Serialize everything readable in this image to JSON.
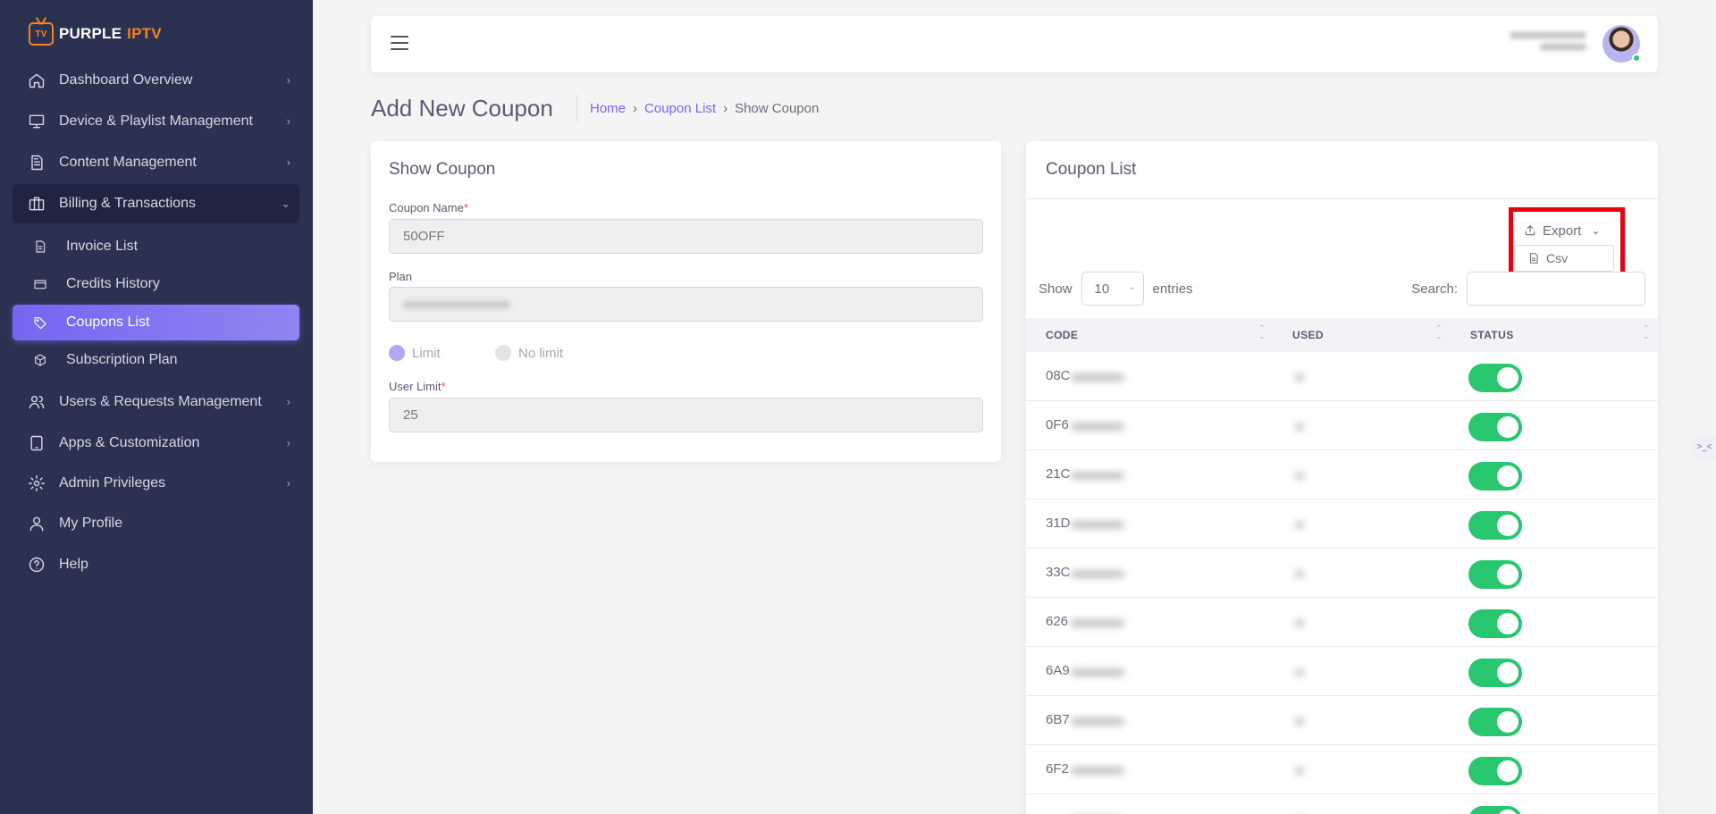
{
  "brand": {
    "purple": "PURPLE",
    "iptv": "IPTV",
    "tv": "TV",
    "accent": "#f58220"
  },
  "sidebar": {
    "items": [
      {
        "label": "Dashboard Overview",
        "icon": "home-icon"
      },
      {
        "label": "Device & Playlist Management",
        "icon": "monitor-icon"
      },
      {
        "label": "Content Management",
        "icon": "document-icon"
      },
      {
        "label": "Billing & Transactions",
        "icon": "briefcase-icon"
      },
      {
        "label": "Users & Requests Management",
        "icon": "users-icon"
      },
      {
        "label": "Apps & Customization",
        "icon": "tablet-icon"
      },
      {
        "label": "Admin Privileges",
        "icon": "gear-icon"
      },
      {
        "label": "My Profile",
        "icon": "user-icon"
      },
      {
        "label": "Help",
        "icon": "help-icon"
      }
    ],
    "billing_sub": [
      {
        "label": "Invoice List",
        "icon": "file-icon"
      },
      {
        "label": "Credits History",
        "icon": "credit-card-icon"
      },
      {
        "label": "Coupons List",
        "icon": "tag-icon",
        "active": true
      },
      {
        "label": "Subscription Plan",
        "icon": "box-icon"
      }
    ]
  },
  "page": {
    "title": "Add New Coupon",
    "breadcrumb": {
      "home": "Home",
      "list": "Coupon List",
      "current": "Show Coupon",
      "separator": "›"
    }
  },
  "form": {
    "title": "Show Coupon",
    "coupon_name_label": "Coupon Name",
    "coupon_name_value": "50OFF",
    "plan_label": "Plan",
    "radio_limit": "Limit",
    "radio_nolimit": "No limit",
    "user_limit_label": "User Limit",
    "user_limit_value": "25",
    "required_mark": "*"
  },
  "coupon_list": {
    "title": "Coupon List",
    "export_label": "Export",
    "csv_label": "Csv",
    "show_label": "Show",
    "entries_value": "10",
    "entries_label": "entries",
    "search_label": "Search:",
    "columns": {
      "code": "CODE",
      "used": "USED",
      "status": "STATUS"
    },
    "rows": [
      {
        "code": "08C",
        "status": "on"
      },
      {
        "code": "0F6",
        "status": "on"
      },
      {
        "code": "21C",
        "status": "on"
      },
      {
        "code": "31D",
        "status": "on"
      },
      {
        "code": "33C",
        "status": "on"
      },
      {
        "code": "626",
        "status": "on"
      },
      {
        "code": "6A9",
        "status": "on"
      },
      {
        "code": "6B7",
        "status": "on"
      },
      {
        "code": "6F2",
        "status": "on"
      },
      {
        "code": "",
        "status": "on"
      }
    ]
  },
  "colors": {
    "primary": "#7367f0",
    "sidebar_bg": "#2b3150",
    "toggle_on": "#28c76f",
    "highlight": "#e8000f"
  }
}
